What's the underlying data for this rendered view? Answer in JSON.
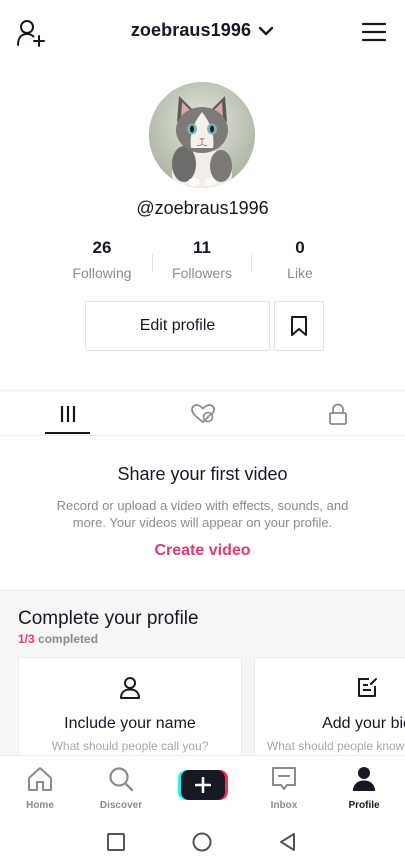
{
  "header": {
    "username": "zoebraus1996"
  },
  "profile": {
    "handle": "@zoebraus1996",
    "stats": [
      {
        "value": "26",
        "label": "Following"
      },
      {
        "value": "11",
        "label": "Followers"
      },
      {
        "value": "0",
        "label": "Like"
      }
    ],
    "edit_label": "Edit profile"
  },
  "empty_state": {
    "title": "Share your first video",
    "description": "Record or upload a video with effects, sounds, and more. Your videos will appear on your profile.",
    "cta": "Create video"
  },
  "complete_profile": {
    "title": "Complete your profile",
    "progress_done": "1/3",
    "progress_label": "completed",
    "cards": [
      {
        "title": "Include your name",
        "subtitle": "What should people call you?",
        "icon": "person-icon"
      },
      {
        "title": "Add your bio",
        "subtitle": "What should people know about you?",
        "icon": "edit-bio-icon"
      }
    ]
  },
  "bottom_nav": [
    {
      "label": "Home",
      "icon": "home-icon"
    },
    {
      "label": "Discover",
      "icon": "search-icon"
    },
    {
      "label": "Inbox",
      "icon": "inbox-icon"
    },
    {
      "label": "Profile",
      "icon": "profile-icon",
      "active": true
    }
  ],
  "colors": {
    "accent": "#e5386d",
    "text": "#161823",
    "muted": "#8a8b91"
  }
}
